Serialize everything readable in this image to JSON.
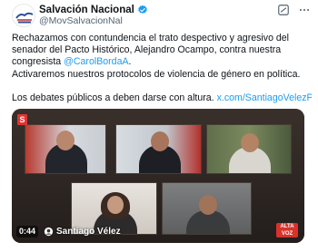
{
  "author": {
    "display_name": "Salvación Nacional",
    "handle": "@MovSalvacionNal"
  },
  "tweet": {
    "line1": "Rechazamos con contundencia el trato despectivo y agresivo del",
    "line2": "senador del Pacto Histórico, Alejandro Ocampo, contra nuestra",
    "line3_prefix": "congresista ",
    "mention": "@CarolBordaA",
    "line3_suffix": ".",
    "line4": "Activaremos nuestros protocolos de violencia de género en política.",
    "line5_prefix": "Los debates públicos a deben darse con altura. ",
    "link": "x.com/SantiagoVelezP…"
  },
  "media": {
    "video_time": "0:44",
    "caption": "Santiago Vélez",
    "channel_logo": "S",
    "corner_logo_text": "ALTA VOZ"
  },
  "colors": {
    "link": "#1d9bf0",
    "verified": "#1d9bf0",
    "text": "#0f1419",
    "secondary": "#536471"
  },
  "icons": {
    "verified": "verified-badge-icon",
    "grok": "grok-icon",
    "more": "more-options-icon",
    "caption_badge": "face-icon"
  }
}
